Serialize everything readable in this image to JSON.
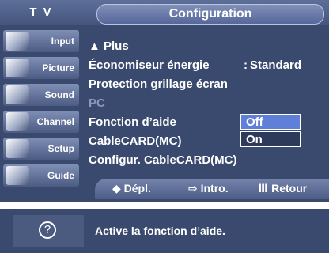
{
  "header": {
    "tv_label": "T V",
    "title": "Configuration"
  },
  "sidebar": {
    "items": [
      {
        "label": "Input",
        "icon": "input-icon"
      },
      {
        "label": "Picture",
        "icon": "picture-icon"
      },
      {
        "label": "Sound",
        "icon": "sound-icon"
      },
      {
        "label": "Channel",
        "icon": "channel-icon"
      },
      {
        "label": "Setup",
        "icon": "setup-icon"
      },
      {
        "label": "Guide",
        "icon": "guide-icon"
      }
    ]
  },
  "menu": {
    "items": [
      {
        "label": "▲ Plus"
      },
      {
        "label": "Économiseur énergie",
        "separator": ":",
        "value": "Standard"
      },
      {
        "label": "Protection grillage écran"
      },
      {
        "label": "PC",
        "state": "disabled"
      },
      {
        "label": "Fonction d’aide",
        "separator": ":"
      },
      {
        "label": "CableCARD(MC)"
      },
      {
        "label": "Configur. CableCARD(MC)"
      }
    ]
  },
  "dropdown": {
    "options": [
      "Off",
      "On"
    ],
    "selected": "Off"
  },
  "bottombar": {
    "move": "◆ Dépl.",
    "enter": "⇨ Intro.",
    "return": "Ⅲ Retour"
  },
  "help": {
    "text": "Active la fonction d’aide."
  },
  "colors": {
    "panel_bg": "#3a4a6e",
    "highlight": "#5f7fd8",
    "text": "#ffffff"
  }
}
